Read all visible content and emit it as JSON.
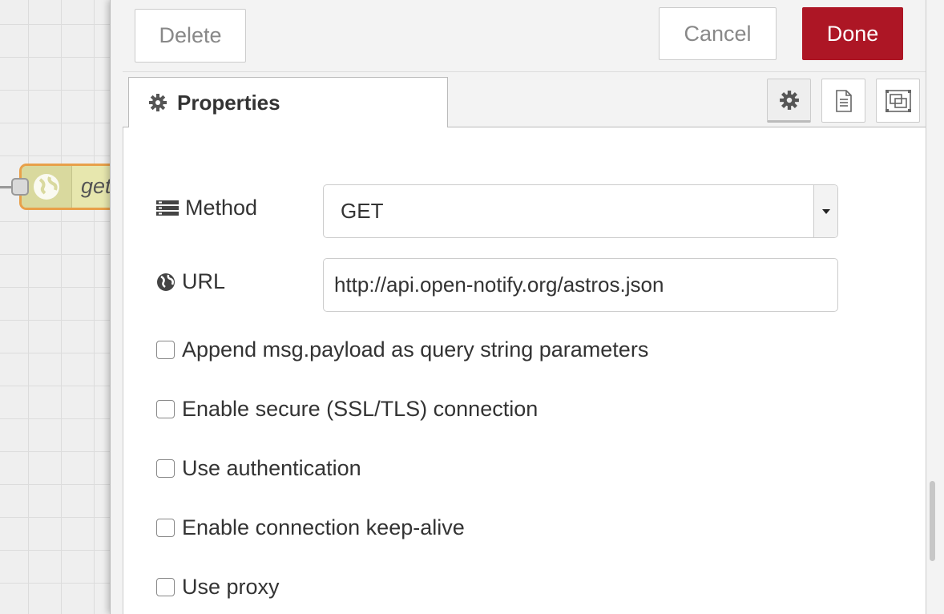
{
  "workspace": {
    "node_label": "get"
  },
  "toolbar": {
    "delete_label": "Delete",
    "cancel_label": "Cancel",
    "done_label": "Done",
    "done_color": "#ad1625"
  },
  "tabs": {
    "properties_label": "Properties"
  },
  "icons": {
    "settings": "gear-icon",
    "description": "document-icon",
    "appearance": "frame-icon"
  },
  "form": {
    "method": {
      "label": "Method",
      "value": "GET"
    },
    "url": {
      "label": "URL",
      "value": "http://api.open-notify.org/astros.json"
    },
    "checkboxes": [
      {
        "label": "Append msg.payload as query string parameters",
        "checked": false
      },
      {
        "label": "Enable secure (SSL/TLS) connection",
        "checked": false
      },
      {
        "label": "Use authentication",
        "checked": false
      },
      {
        "label": "Enable connection keep-alive",
        "checked": false
      },
      {
        "label": "Use proxy",
        "checked": false
      }
    ]
  }
}
